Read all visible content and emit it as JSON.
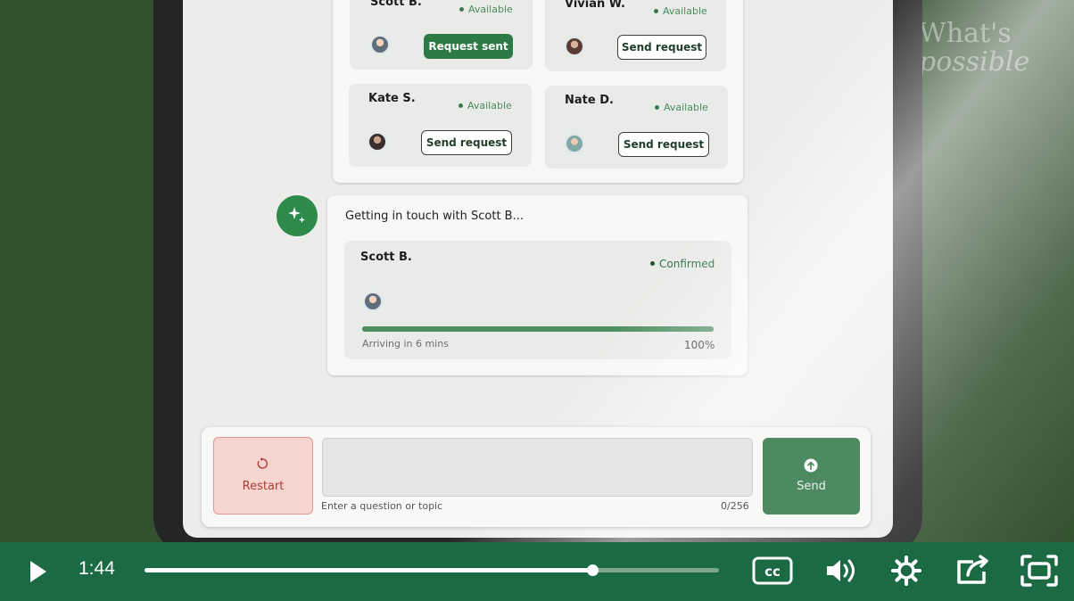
{
  "watermark": {
    "line1": "What's",
    "line2": "possible"
  },
  "drivers": [
    {
      "name": "Scott B.",
      "status": "Available",
      "action": "Request sent",
      "state": "sent"
    },
    {
      "name": "Vivian W.",
      "status": "Available",
      "action": "Send request",
      "state": "idle"
    },
    {
      "name": "Kate S.",
      "status": "Available",
      "action": "Send request",
      "state": "idle"
    },
    {
      "name": "Nate D.",
      "status": "Available",
      "action": "Send request",
      "state": "idle"
    }
  ],
  "assistant": {
    "icon": "sparkle-icon",
    "message": "Getting in touch with Scott B...",
    "confirmation": {
      "name": "Scott B.",
      "status": "Confirmed",
      "eta": "Arriving in 6 mins",
      "progress_percent": 100,
      "progress_label": "100%"
    }
  },
  "composer": {
    "restart_label": "Restart",
    "input_value": "",
    "input_hint": "Enter a question or topic",
    "char_count": "0/256",
    "send_label": "Send"
  },
  "player": {
    "time": "1:44",
    "progress_fraction": 0.78,
    "colors": {
      "bar": "#1b6a44",
      "track": "#7fa58e",
      "fill": "#ffffff"
    }
  }
}
